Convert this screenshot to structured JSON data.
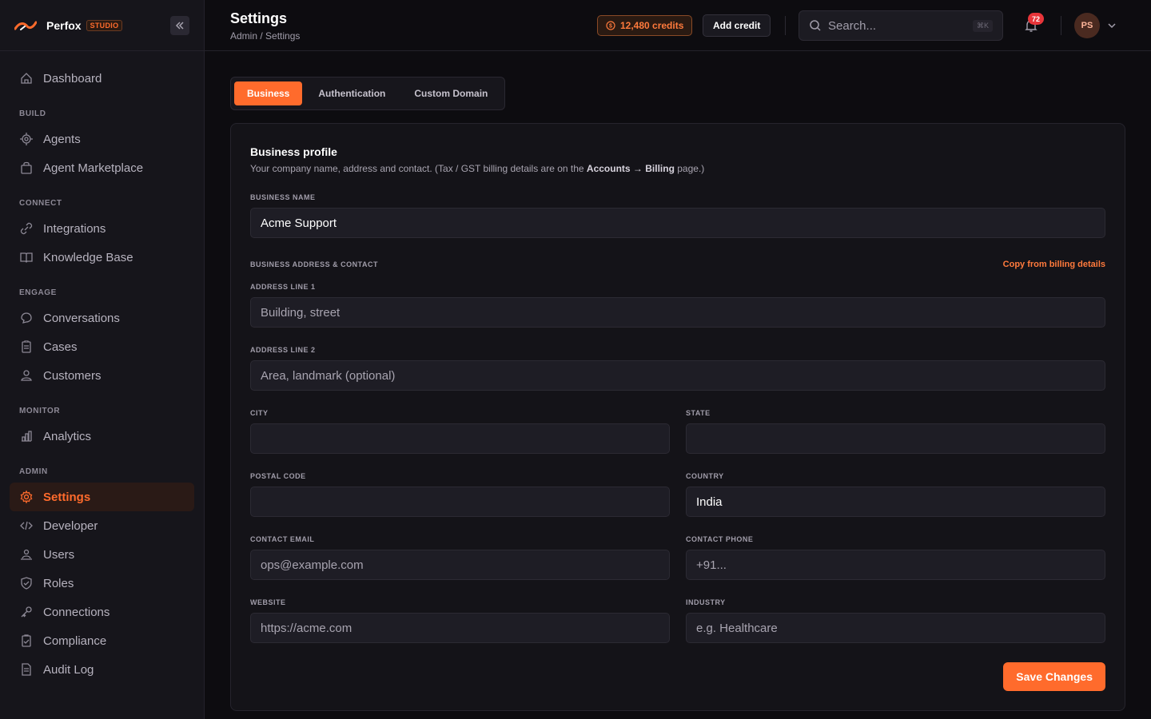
{
  "brand": {
    "name": "Perfox",
    "badge": "STUDIO",
    "accent": "#ff6b2c"
  },
  "sidebar": {
    "items": [
      {
        "label": "Dashboard",
        "icon": "home-icon"
      },
      {
        "section": "BUILD"
      },
      {
        "label": "Agents",
        "icon": "cpu-icon"
      },
      {
        "label": "Agent Marketplace",
        "icon": "bag-icon"
      },
      {
        "section": "CONNECT"
      },
      {
        "label": "Integrations",
        "icon": "link-icon"
      },
      {
        "label": "Knowledge Base",
        "icon": "book-icon"
      },
      {
        "section": "ENGAGE"
      },
      {
        "label": "Conversations",
        "icon": "chat-icon"
      },
      {
        "label": "Cases",
        "icon": "clipboard-icon"
      },
      {
        "label": "Customers",
        "icon": "users-icon"
      },
      {
        "section": "MONITOR"
      },
      {
        "label": "Analytics",
        "icon": "bar-chart-icon"
      },
      {
        "section": "ADMIN"
      },
      {
        "label": "Settings",
        "icon": "gear-icon",
        "active": true
      },
      {
        "label": "Developer",
        "icon": "code-icon"
      },
      {
        "label": "Users",
        "icon": "user-group-icon"
      },
      {
        "label": "Roles",
        "icon": "shield-icon"
      },
      {
        "label": "Connections",
        "icon": "key-icon"
      },
      {
        "label": "Compliance",
        "icon": "clipboard-check-icon"
      },
      {
        "label": "Audit Log",
        "icon": "document-icon"
      }
    ]
  },
  "header": {
    "title": "Settings",
    "breadcrumb": "Admin / Settings",
    "credits": "12,480 credits",
    "add_credit": "Add credit",
    "search_placeholder": "Search...",
    "search_shortcut": "⌘K",
    "notifications": "72",
    "avatar": "PS"
  },
  "tabs": [
    {
      "label": "Business",
      "active": true
    },
    {
      "label": "Authentication"
    },
    {
      "label": "Custom Domain"
    }
  ],
  "form": {
    "title": "Business profile",
    "desc_prefix": "Your company name, address and contact. (Tax / GST billing details are on the ",
    "desc_bold": "Accounts → Billing",
    "desc_suffix": " page.)",
    "business_name_label": "BUSINESS NAME",
    "business_name_value": "Acme Support",
    "address_section_label": "BUSINESS ADDRESS & CONTACT",
    "copy_link": "Copy from billing details",
    "address1_label": "ADDRESS LINE 1",
    "address1_placeholder": "Building, street",
    "address2_label": "ADDRESS LINE 2",
    "address2_placeholder": "Area, landmark (optional)",
    "city_label": "CITY",
    "state_label": "STATE",
    "postal_label": "POSTAL CODE",
    "country_label": "COUNTRY",
    "country_value": "India",
    "email_label": "CONTACT EMAIL",
    "email_placeholder": "ops@example.com",
    "phone_label": "CONTACT PHONE",
    "phone_placeholder": "+91...",
    "website_label": "WEBSITE",
    "website_placeholder": "https://acme.com",
    "industry_label": "INDUSTRY",
    "industry_placeholder": "e.g. Healthcare",
    "save_label": "Save Changes"
  }
}
